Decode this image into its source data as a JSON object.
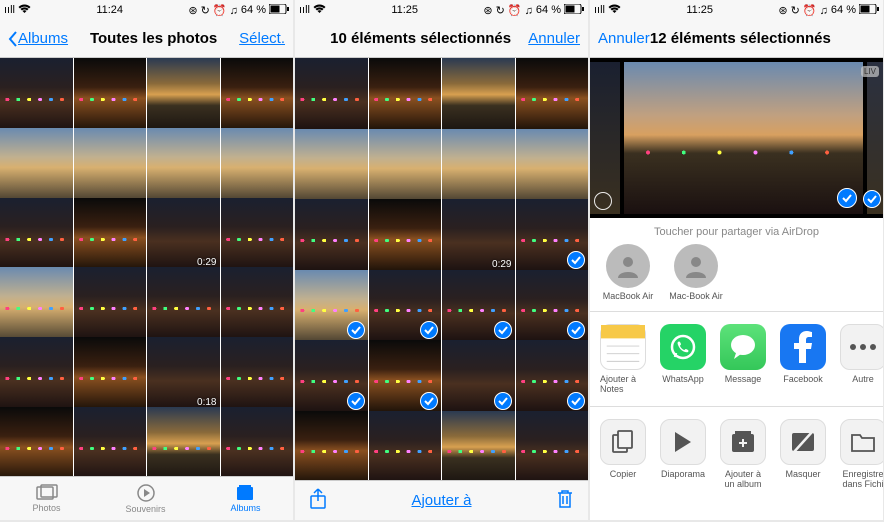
{
  "status": {
    "carrier_signal": "ııll",
    "wifi": "wifi",
    "battery_pct": "64 %",
    "extra_icons": "⊕ ↗ ⏰ ⌂"
  },
  "screen1": {
    "time": "11:24",
    "back_label": "Albums",
    "title": "Toutes les photos",
    "select_label": "Sélect.",
    "tabs": {
      "photos": "Photos",
      "souvenirs": "Souvenirs",
      "albums": "Albums"
    },
    "durations": {
      "cell_10": "0:29",
      "cell_18": "0:18"
    }
  },
  "screen2": {
    "time": "11:25",
    "title": "10 éléments sélectionnés",
    "cancel_label": "Annuler",
    "toolbar": {
      "add_to": "Ajouter à"
    },
    "durations": {
      "cell_10": "0:29"
    }
  },
  "screen3": {
    "time": "11:25",
    "cancel_label": "Annuler",
    "title": "12 éléments sélectionnés",
    "live_badge": "LIV",
    "airdrop_hint": "Toucher pour partager via AirDrop",
    "contacts": [
      {
        "name": "MacBook Air"
      },
      {
        "name": "Mac-Book Air"
      }
    ],
    "apps": [
      {
        "name": "Ajouter à Notes",
        "bg": "#fff",
        "accent": "#f7c948"
      },
      {
        "name": "WhatsApp",
        "bg": "#25D366"
      },
      {
        "name": "Message",
        "bg": "#34C759"
      },
      {
        "name": "Facebook",
        "bg": "#1877F2"
      },
      {
        "name": "Autre",
        "bg": "#fff"
      }
    ],
    "actions": [
      {
        "name": "Copier"
      },
      {
        "name": "Diaporama"
      },
      {
        "name": "Ajouter à un album"
      },
      {
        "name": "Masquer"
      },
      {
        "name": "Enregistre dans Fichi"
      }
    ]
  }
}
